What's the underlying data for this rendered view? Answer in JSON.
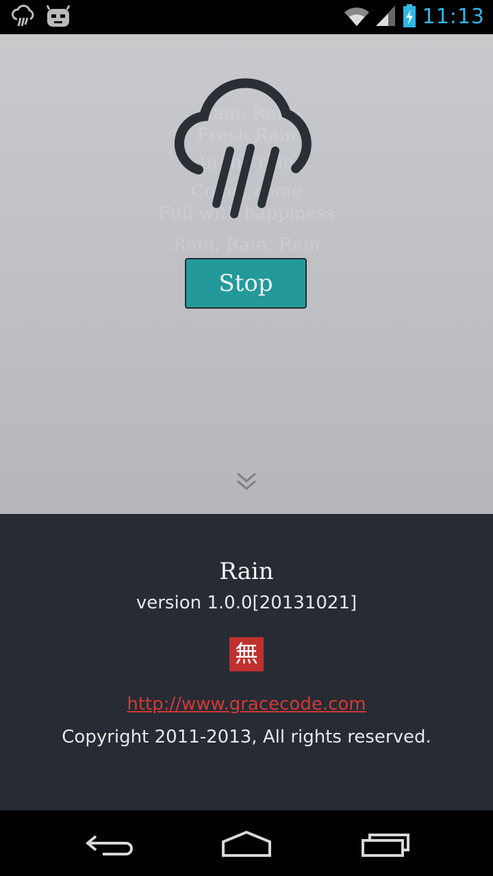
{
  "status_bar": {
    "time": "11:13",
    "icons": [
      "rain-notification-icon",
      "cyanogenmod-icon",
      "wifi-icon",
      "signal-icon",
      "battery-charging-icon"
    ],
    "accent_color": "#33b5e5"
  },
  "hero": {
    "ghost_lines": [
      "Rain, Rain",
      "Fresh Rain",
      "In the rain",
      "Come, come",
      "Full with happiness",
      "Rain, Rain, Rain",
      "come"
    ],
    "icon": "rain-cloud-icon",
    "stop_label": "Stop",
    "button_color": "#24999a",
    "scroll_hint_icon": "double-chevron-down-icon"
  },
  "about": {
    "app_name": "Rain",
    "version": "version 1.0.0[20131021]",
    "logo_char": "無",
    "logo_color": "#c0302e",
    "url": "http://www.gracecode.com",
    "copyright": "Copyright 2011-2013, All rights reserved."
  },
  "nav_bar": {
    "buttons": [
      "back-icon",
      "home-icon",
      "recent-apps-icon"
    ]
  }
}
